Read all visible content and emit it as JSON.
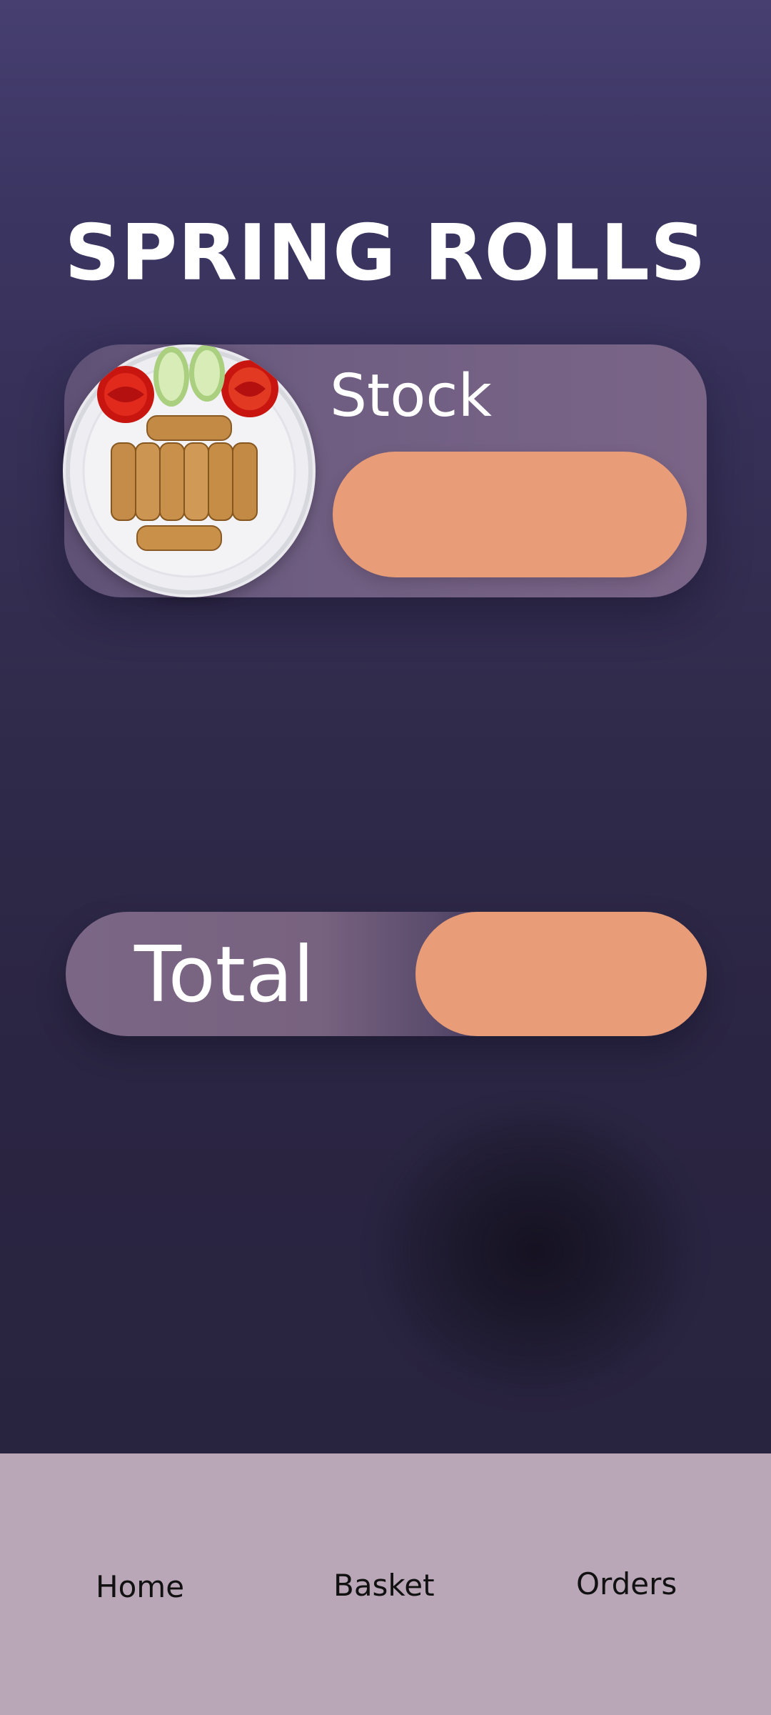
{
  "page": {
    "title": "SPRING ROLLS"
  },
  "item": {
    "image_icon": "spring-rolls-plate-image",
    "stock_label": "Stock",
    "stock_value": ""
  },
  "total": {
    "label": "Total",
    "value": ""
  },
  "nav": {
    "items": [
      {
        "label": "Home"
      },
      {
        "label": "Basket"
      },
      {
        "label": "Orders"
      }
    ]
  },
  "colors": {
    "background_top": "#463f70",
    "background_bottom": "#27223d",
    "card": "#6f5e82",
    "accent_pill": "#e89c77",
    "nav_bar": "#b9a7b7",
    "title_text": "#ffffff"
  }
}
